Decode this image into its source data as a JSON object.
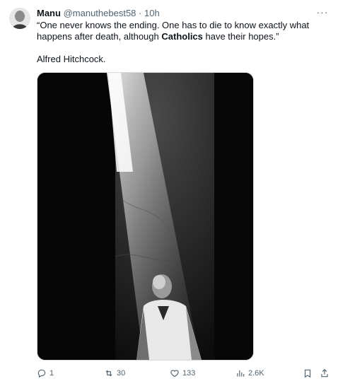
{
  "tweet": {
    "author_name": "Manu",
    "handle": "@manuthebest58",
    "separator": "·",
    "time": "10h",
    "more_label": "···",
    "text_part1": "“One never knows the ending. One has to die to know exactly what happens after death, although ",
    "text_bold": "Catholics",
    "text_part2": " have their hopes.”",
    "attribution": "Alfred Hitchcock."
  },
  "actions": {
    "reply_count": "1",
    "repost_count": "30",
    "like_count": "133",
    "views_count": "2.6K"
  },
  "icons": {
    "avatar": "avatar-photo",
    "more": "more-icon",
    "reply": "reply-icon",
    "repost": "repost-icon",
    "like": "heart-icon",
    "views": "views-icon",
    "bookmark": "bookmark-icon",
    "share": "share-icon"
  },
  "colors": {
    "text": "#0f1419",
    "secondary": "#536471",
    "border": "#cfd9de"
  }
}
